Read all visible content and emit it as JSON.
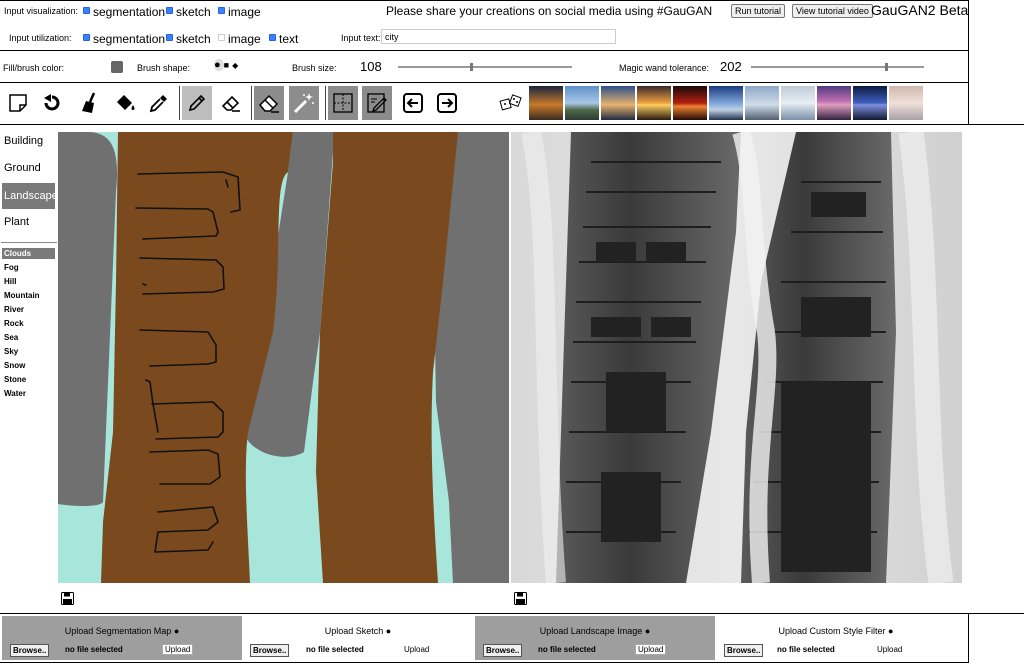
{
  "top": {
    "input_visualization_label": "Input visualization:",
    "viz_options": [
      {
        "label": "segmentation",
        "checked": true
      },
      {
        "label": "sketch",
        "checked": true
      },
      {
        "label": "image",
        "checked": true
      }
    ],
    "share_message": "Please share your creations on social media using #GauGAN",
    "run_tutorial": "Run tutorial",
    "view_tutorial_video": "View tutorial video",
    "app_title": "GauGAN2 Beta",
    "input_utilization_label": "Input utilization:",
    "util_options": [
      {
        "label": "segmentation",
        "checked": true
      },
      {
        "label": "sketch",
        "checked": true
      },
      {
        "label": "image",
        "checked": false
      },
      {
        "label": "text",
        "checked": true
      }
    ],
    "input_text_label": "Input text:",
    "input_text_value": "city"
  },
  "brush": {
    "fill_label": "Fill/brush color:",
    "fill_color": "#666666",
    "shape_label": "Brush shape:",
    "shapes": [
      "●",
      "■",
      "◆"
    ],
    "size_label": "Brush size:",
    "size_value": "108",
    "size_fraction": 0.42,
    "wand_label": "Magic wand tolerance:",
    "wand_value": "202",
    "wand_fraction": 0.79
  },
  "toolbar": {
    "icons": [
      "new-canvas-icon",
      "undo-icon",
      "broom-icon",
      "paint-bucket-icon",
      "eyedropper-icon",
      "pencil-icon",
      "eraser-outline-icon",
      "eraser-icon",
      "magic-wand-icon",
      "segmentation-grid-icon",
      "sketch-edit-icon",
      "arrow-left-icon",
      "arrow-right-icon",
      "dice-icon"
    ],
    "style_thumbnails": 11
  },
  "categories": {
    "main": [
      "Building",
      "Ground",
      "Landscape",
      "Plant"
    ],
    "selected_main": "Landscape",
    "sub": [
      "Clouds",
      "Fog",
      "Hill",
      "Mountain",
      "River",
      "Rock",
      "Sea",
      "Sky",
      "Snow",
      "Stone",
      "Water"
    ],
    "selected_sub": "Clouds"
  },
  "canvas": {
    "bg_color": "#a8e6dc",
    "building_color": "#7a4a1e",
    "rock_color": "#707070"
  },
  "uploads": [
    {
      "title": "Upload Segmentation Map",
      "browse": "Browse..",
      "file": "no file selected",
      "upload": "Upload",
      "shaded": true
    },
    {
      "title": "Upload Sketch",
      "browse": "Browse..",
      "file": "no file selected",
      "upload": "Upload",
      "shaded": false
    },
    {
      "title": "Upload Landscape Image",
      "browse": "Browse..",
      "file": "no file selected",
      "upload": "Upload",
      "shaded": true
    },
    {
      "title": "Upload Custom Style Filter",
      "browse": "Browse..",
      "file": "no file selected",
      "upload": "Upload",
      "shaded": false
    }
  ]
}
